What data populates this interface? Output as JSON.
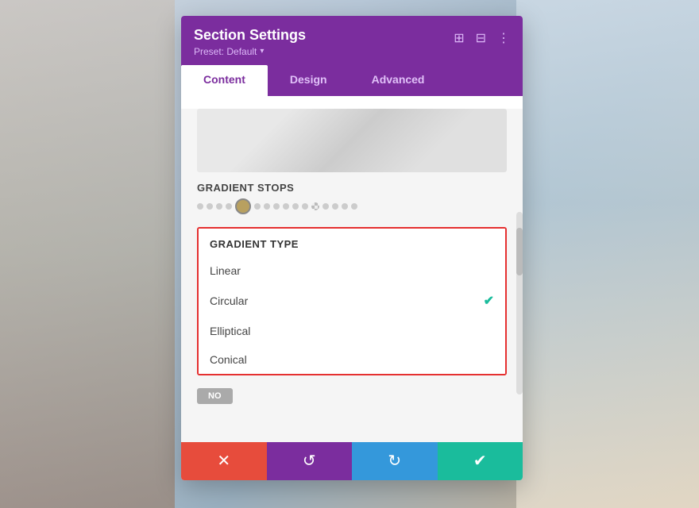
{
  "background": {
    "color": "#c0c8d0"
  },
  "modal": {
    "title": "Section Settings",
    "preset_label": "Preset: Default",
    "preset_arrow": "▾",
    "icons": {
      "expand": "⊞",
      "grid": "⊟",
      "more": "⋮"
    }
  },
  "tabs": [
    {
      "id": "content",
      "label": "Content",
      "active": true
    },
    {
      "id": "design",
      "label": "Design",
      "active": false
    },
    {
      "id": "advanced",
      "label": "Advanced",
      "active": false
    }
  ],
  "gradient_stops": {
    "label": "Gradient Stops"
  },
  "gradient_type": {
    "label": "Gradient Type",
    "options": [
      {
        "id": "linear",
        "label": "Linear",
        "selected": false
      },
      {
        "id": "circular",
        "label": "Circular",
        "selected": true
      },
      {
        "id": "elliptical",
        "label": "Elliptical",
        "selected": false
      },
      {
        "id": "conical",
        "label": "Conical",
        "selected": false
      }
    ]
  },
  "no_toggle": {
    "label": "No"
  },
  "footer": {
    "cancel_icon": "✕",
    "undo_icon": "↺",
    "redo_icon": "↻",
    "save_icon": "✔"
  }
}
